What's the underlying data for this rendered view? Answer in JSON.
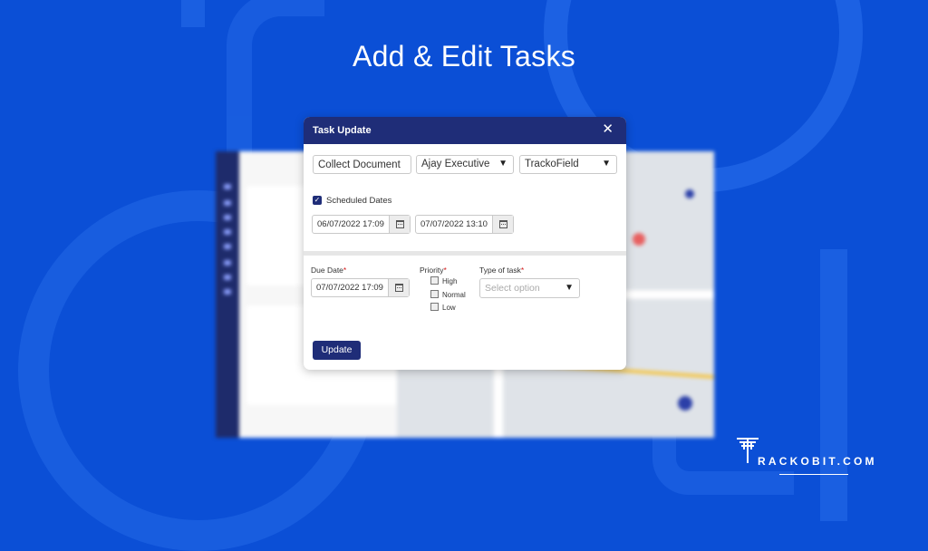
{
  "page": {
    "headline": "Add & Edit Tasks",
    "brand": "RACKOBIT.COM",
    "brand_logo_icon": "trackobit-logo-icon"
  },
  "modal": {
    "title": "Task Update",
    "close_icon": "close-icon",
    "task_name": "Collect Document",
    "executive": "Ajay Executive",
    "form_type": "TrackoField",
    "scheduled_dates_label": "Scheduled Dates",
    "scheduled_dates_checked": true,
    "scheduled_start": "06/07/2022 17:09",
    "scheduled_end": "07/07/2022 13:10",
    "due_date_label": "Due Date",
    "due_date": "07/07/2022 17:09",
    "priority_label": "Priority",
    "priority_options": [
      "High",
      "Normal",
      "Low"
    ],
    "type_of_task_label": "Type of task",
    "type_of_task_placeholder": "Select option",
    "required_marker": "*",
    "update_button": "Update"
  },
  "colors": {
    "background": "#0b4fd6",
    "modal_header": "#1f2d78",
    "required": "#d21a1a"
  }
}
